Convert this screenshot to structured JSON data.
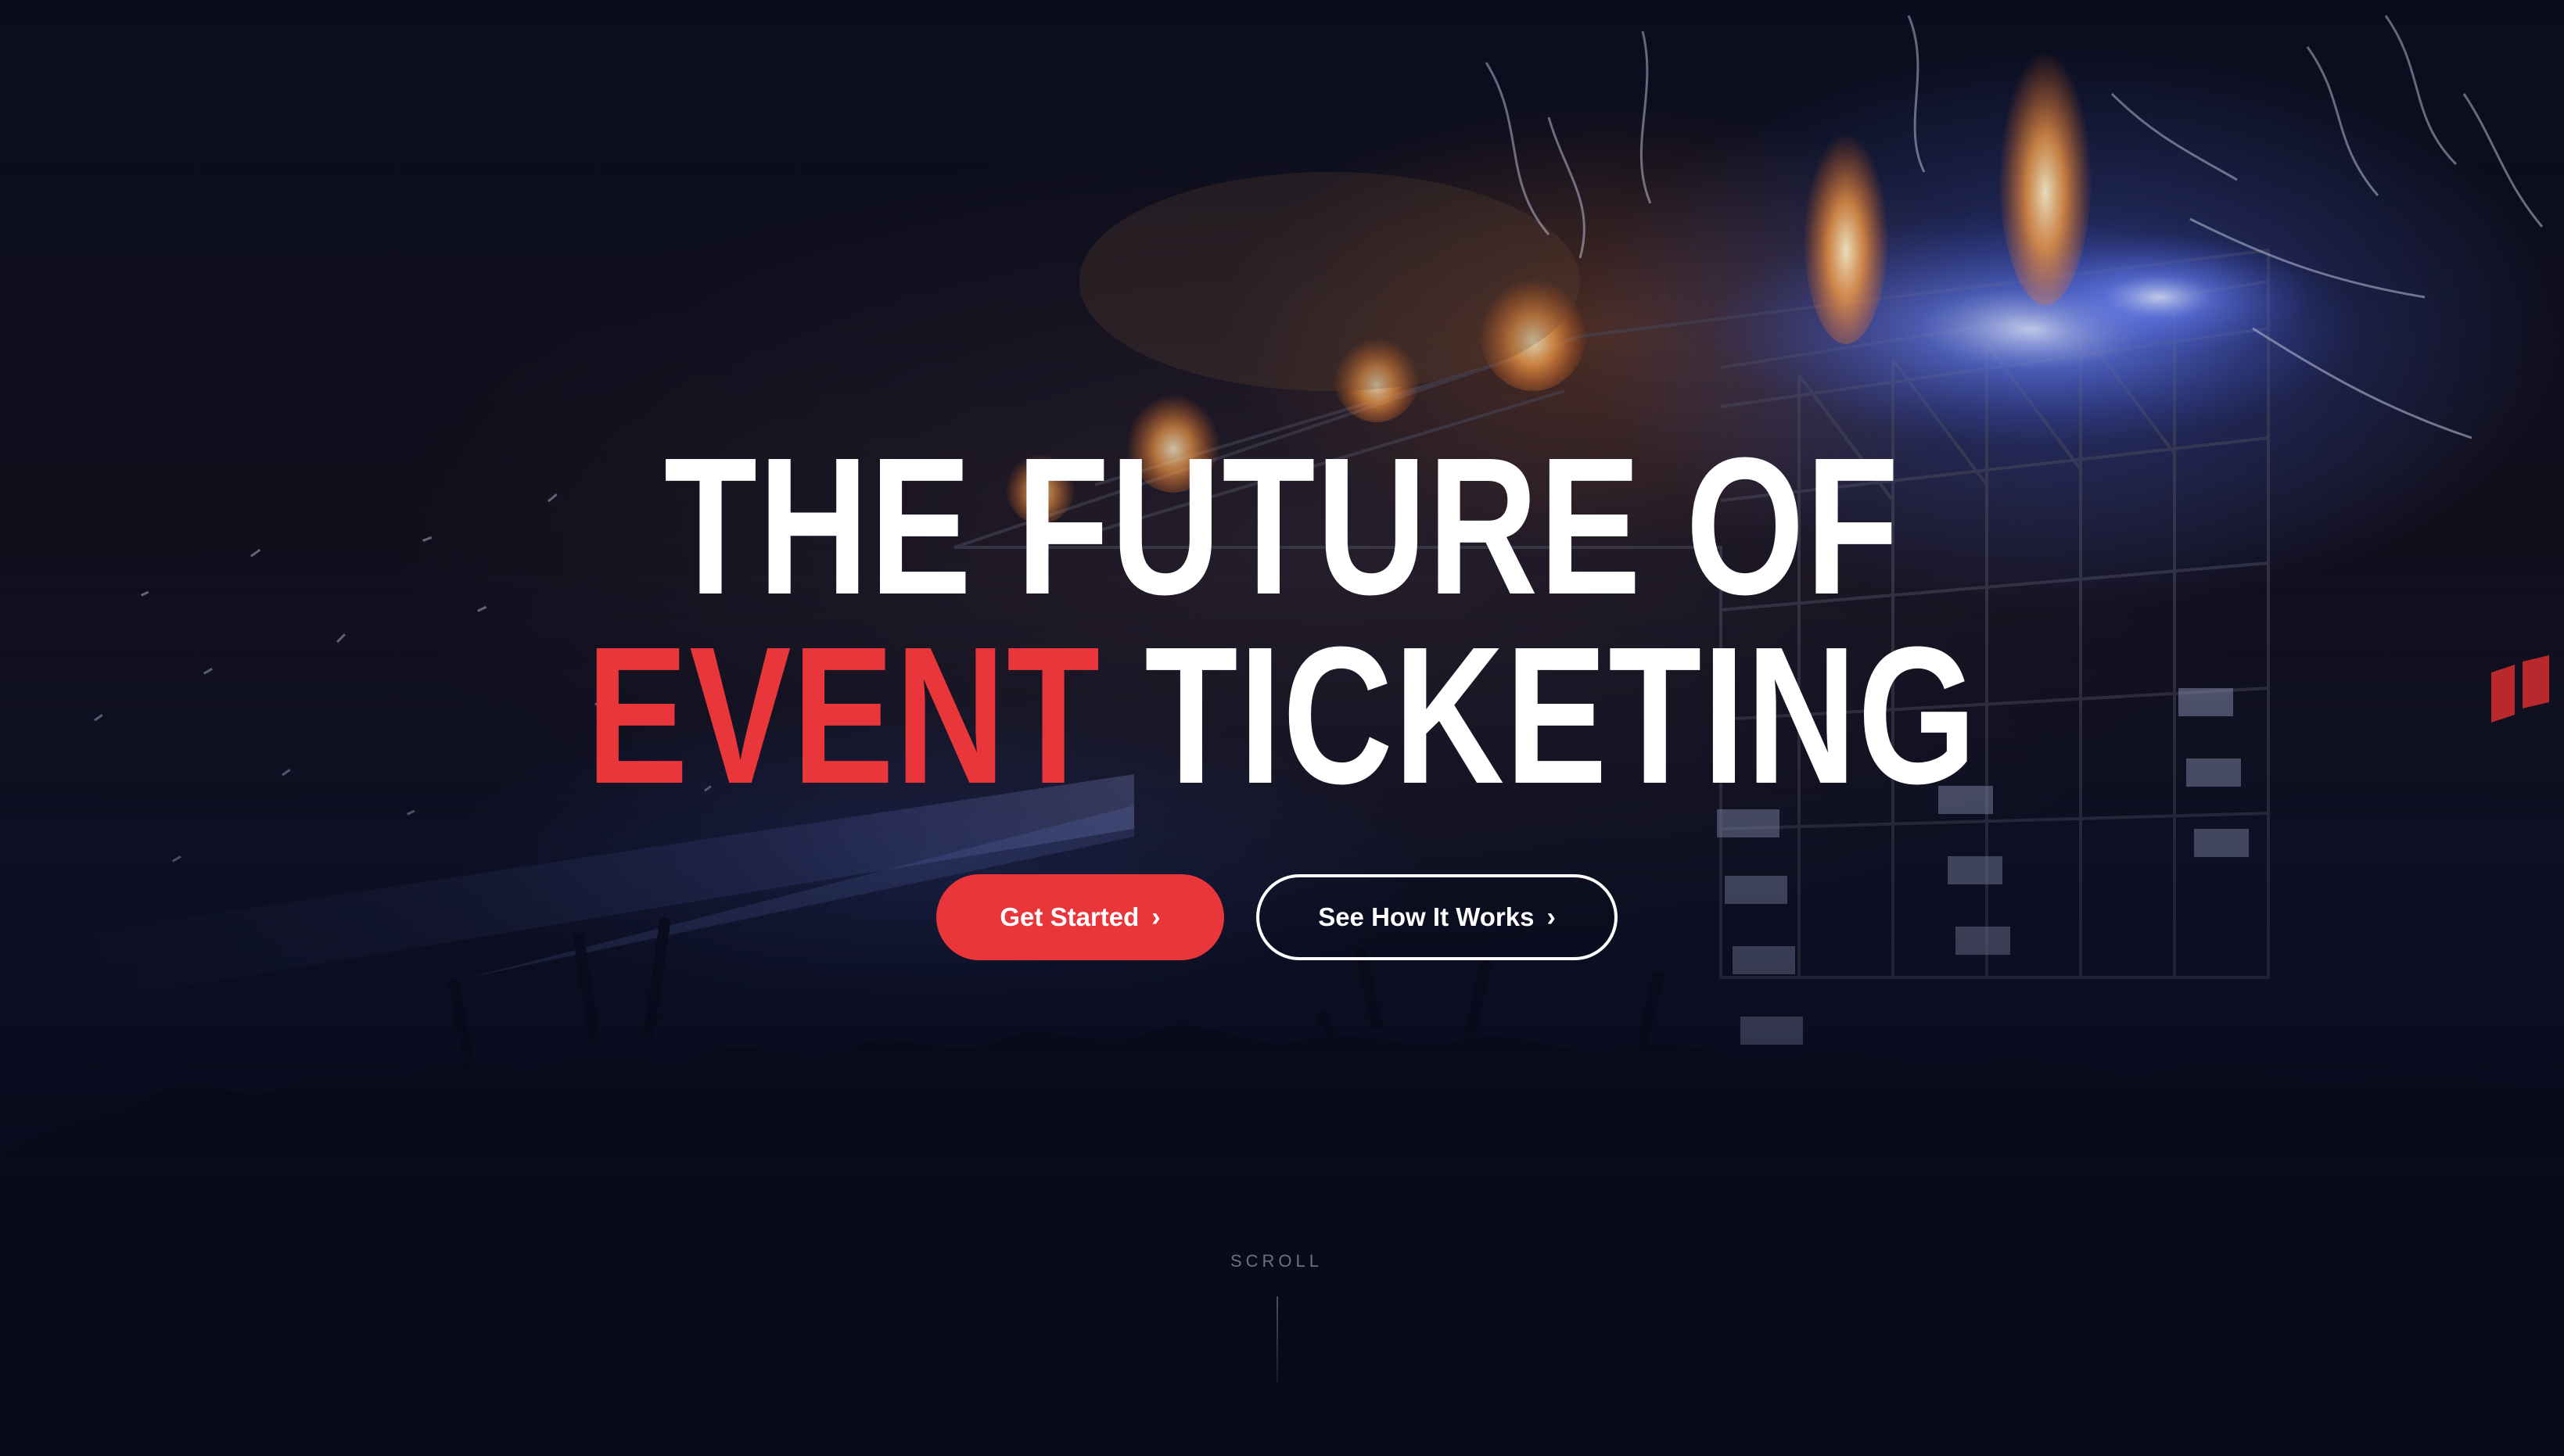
{
  "hero": {
    "headline_line1": "THE FUTURE OF",
    "headline_accent": "EVENT",
    "headline_rest": " TICKETING",
    "accent_color": "#e8363a",
    "background_image": "concert-stage-crowd-image"
  },
  "actions": {
    "primary_label": "Get Started",
    "primary_chevron": "›",
    "secondary_label": "See How It Works",
    "secondary_chevron": "›"
  },
  "scroll": {
    "label": "SCROLL"
  },
  "side_logo": {
    "icon": "brand-mark-icon",
    "color": "#b8282d"
  }
}
